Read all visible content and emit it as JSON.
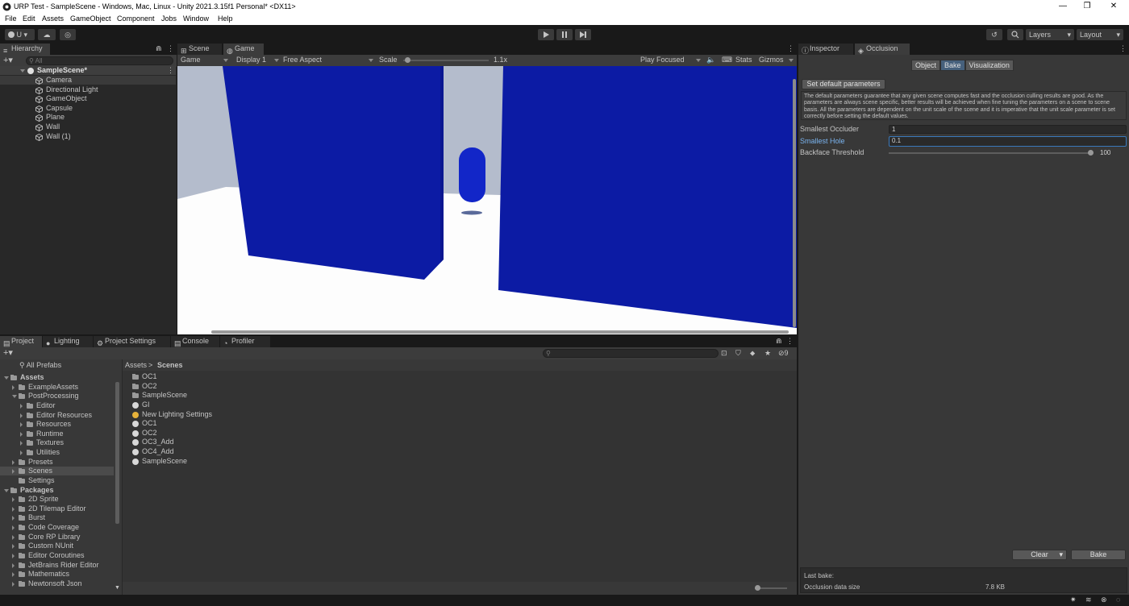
{
  "window": {
    "title": "URP Test - SampleScene - Windows, Mac, Linux - Unity 2021.3.15f1 Personal* <DX11>",
    "controls": [
      "—",
      "❐",
      "✕"
    ]
  },
  "menu": [
    "File",
    "Edit",
    "Assets",
    "GameObject",
    "Component",
    "Jobs",
    "Window",
    "Help"
  ],
  "toolbar": {
    "account_label": "U",
    "layers_label": "Layers",
    "layout_label": "Layout"
  },
  "hierarchy": {
    "tab_label": "Hierarchy",
    "search_placeholder": "All",
    "scene_name": "SampleScene*",
    "items": [
      "Camera",
      "Directional Light",
      "GameObject",
      "Capsule",
      "Plane",
      "Wall",
      "Wall (1)"
    ]
  },
  "game_view": {
    "tabs": [
      "Scene",
      "Game"
    ],
    "mode": "Game",
    "display": "Display 1",
    "aspect": "Free Aspect",
    "scale_label": "Scale",
    "scale_value": "1.1x",
    "play_mode": "Play Focused",
    "stats_label": "Stats",
    "gizmos_label": "Gizmos",
    "colors": {
      "sky": "#b4bccc",
      "wall": "#0c1ba4",
      "floor": "#fdfdfd"
    }
  },
  "inspector": {
    "tabs": [
      "Inspector",
      "Occlusion"
    ],
    "subtabs": [
      "Object",
      "Bake",
      "Visualization"
    ],
    "set_default_label": "Set default parameters",
    "description": "The default parameters guarantee that any given scene computes fast and the occlusion culling results are good. As the parameters are always scene specific, better results will be achieved when fine tuning the parameters on a scene to scene basis. All the parameters are dependent on the unit scale of the scene and it is imperative that the unit scale parameter is set correctly before setting the default values.",
    "fields": [
      {
        "label": "Smallest Occluder",
        "value": "1"
      },
      {
        "label": "Smallest Hole",
        "value": "0.1"
      },
      {
        "label": "Backface Threshold",
        "value": "100"
      }
    ],
    "clear_label": "Clear",
    "bake_label": "Bake",
    "last_bake_label": "Last bake:",
    "occlusion_size_label": "Occlusion data size",
    "occlusion_size_value": "7.8 KB",
    "accent": "#2c5d87"
  },
  "bottom_tabs": [
    "Project",
    "Lighting",
    "Project Settings",
    "Console",
    "Profiler"
  ],
  "project": {
    "hidden_count": "9",
    "all_prefabs": "All Prefabs",
    "breadcrumb": [
      "Assets",
      "Scenes"
    ],
    "tree": [
      {
        "label": "Assets",
        "level": 0,
        "bold": true,
        "open": true
      },
      {
        "label": "ExampleAssets",
        "level": 1
      },
      {
        "label": "PostProcessing",
        "level": 1,
        "open": true
      },
      {
        "label": "Editor",
        "level": 2
      },
      {
        "label": "Editor Resources",
        "level": 2
      },
      {
        "label": "Resources",
        "level": 2
      },
      {
        "label": "Runtime",
        "level": 2
      },
      {
        "label": "Textures",
        "level": 2
      },
      {
        "label": "Utilities",
        "level": 2
      },
      {
        "label": "Presets",
        "level": 1
      },
      {
        "label": "Scenes",
        "level": 1,
        "selected": true
      },
      {
        "label": "Settings",
        "level": 1,
        "leaf": true
      },
      {
        "label": "Packages",
        "level": 0,
        "bold": true,
        "open": true
      },
      {
        "label": "2D Sprite",
        "level": 1
      },
      {
        "label": "2D Tilemap Editor",
        "level": 1
      },
      {
        "label": "Burst",
        "level": 1
      },
      {
        "label": "Code Coverage",
        "level": 1
      },
      {
        "label": "Core RP Library",
        "level": 1
      },
      {
        "label": "Custom NUnit",
        "level": 1
      },
      {
        "label": "Editor Coroutines",
        "level": 1
      },
      {
        "label": "JetBrains Rider Editor",
        "level": 1
      },
      {
        "label": "Mathematics",
        "level": 1
      },
      {
        "label": "Newtonsoft Json",
        "level": 1
      }
    ],
    "files": [
      {
        "label": "OC1",
        "kind": "folder"
      },
      {
        "label": "OC2",
        "kind": "folder"
      },
      {
        "label": "SampleScene",
        "kind": "folder"
      },
      {
        "label": "GI",
        "kind": "scene"
      },
      {
        "label": "New Lighting Settings",
        "kind": "lighting"
      },
      {
        "label": "OC1",
        "kind": "scene"
      },
      {
        "label": "OC2",
        "kind": "scene"
      },
      {
        "label": "OC3_Add",
        "kind": "scene"
      },
      {
        "label": "OC4_Add",
        "kind": "scene"
      },
      {
        "label": "SampleScene",
        "kind": "scene"
      }
    ]
  }
}
